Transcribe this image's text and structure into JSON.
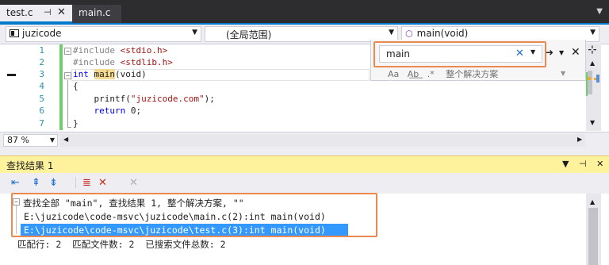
{
  "tabs": [
    {
      "label": "test.c",
      "pin": "⊣",
      "close": "✕"
    },
    {
      "label": "main.c"
    }
  ],
  "tab_overflow": "▼",
  "navbar": {
    "project": "juzicode",
    "scope": "(全局范围)",
    "function": "main(void)"
  },
  "editor": {
    "line_numbers": [
      "1",
      "2",
      "3",
      "4",
      "5",
      "6",
      "7"
    ],
    "lines": [
      {
        "pre": "#include ",
        "inc": "<stdio.h>"
      },
      {
        "pre": "#include ",
        "inc": "<stdlib.h>"
      },
      {
        "kw": "int",
        "sp": " ",
        "hl": "main",
        "rest": "(void)"
      },
      {
        "text": "{"
      },
      {
        "indent": "    ",
        "fn": "printf(",
        "str": "\"juzicode.com\"",
        "end": ");"
      },
      {
        "indent": "    ",
        "kw": "return",
        "end": " 0;"
      },
      {
        "text": "}"
      }
    ]
  },
  "find": {
    "query": "main",
    "scope": "整个解决方案",
    "opt_case": "Aa",
    "opt_word": "A͟b͟",
    "opt_regex": ".*"
  },
  "zoom": "87 %",
  "results": {
    "title": "查找结果 1",
    "actions": {
      "dropdown": "▼",
      "pin": "⊣",
      "close": "✕"
    },
    "summary": "查找全部 \"main\", 查找结果 1, 整个解决方案, \"\"",
    "match1": "E:\\juzicode\\code-msvc\\juzicode\\main.c(2):int main(void)",
    "match2": "E:\\juzicode\\code-msvc\\juzicode\\test.c(3):int main(void)",
    "footer": "匹配行: 2  匹配文件数: 2  已搜索文件总数: 2"
  },
  "colors": {
    "accent": "#007acc",
    "annotation": "#ea8a52",
    "selection": "#3399ff",
    "tool_header": "#fff29d"
  }
}
